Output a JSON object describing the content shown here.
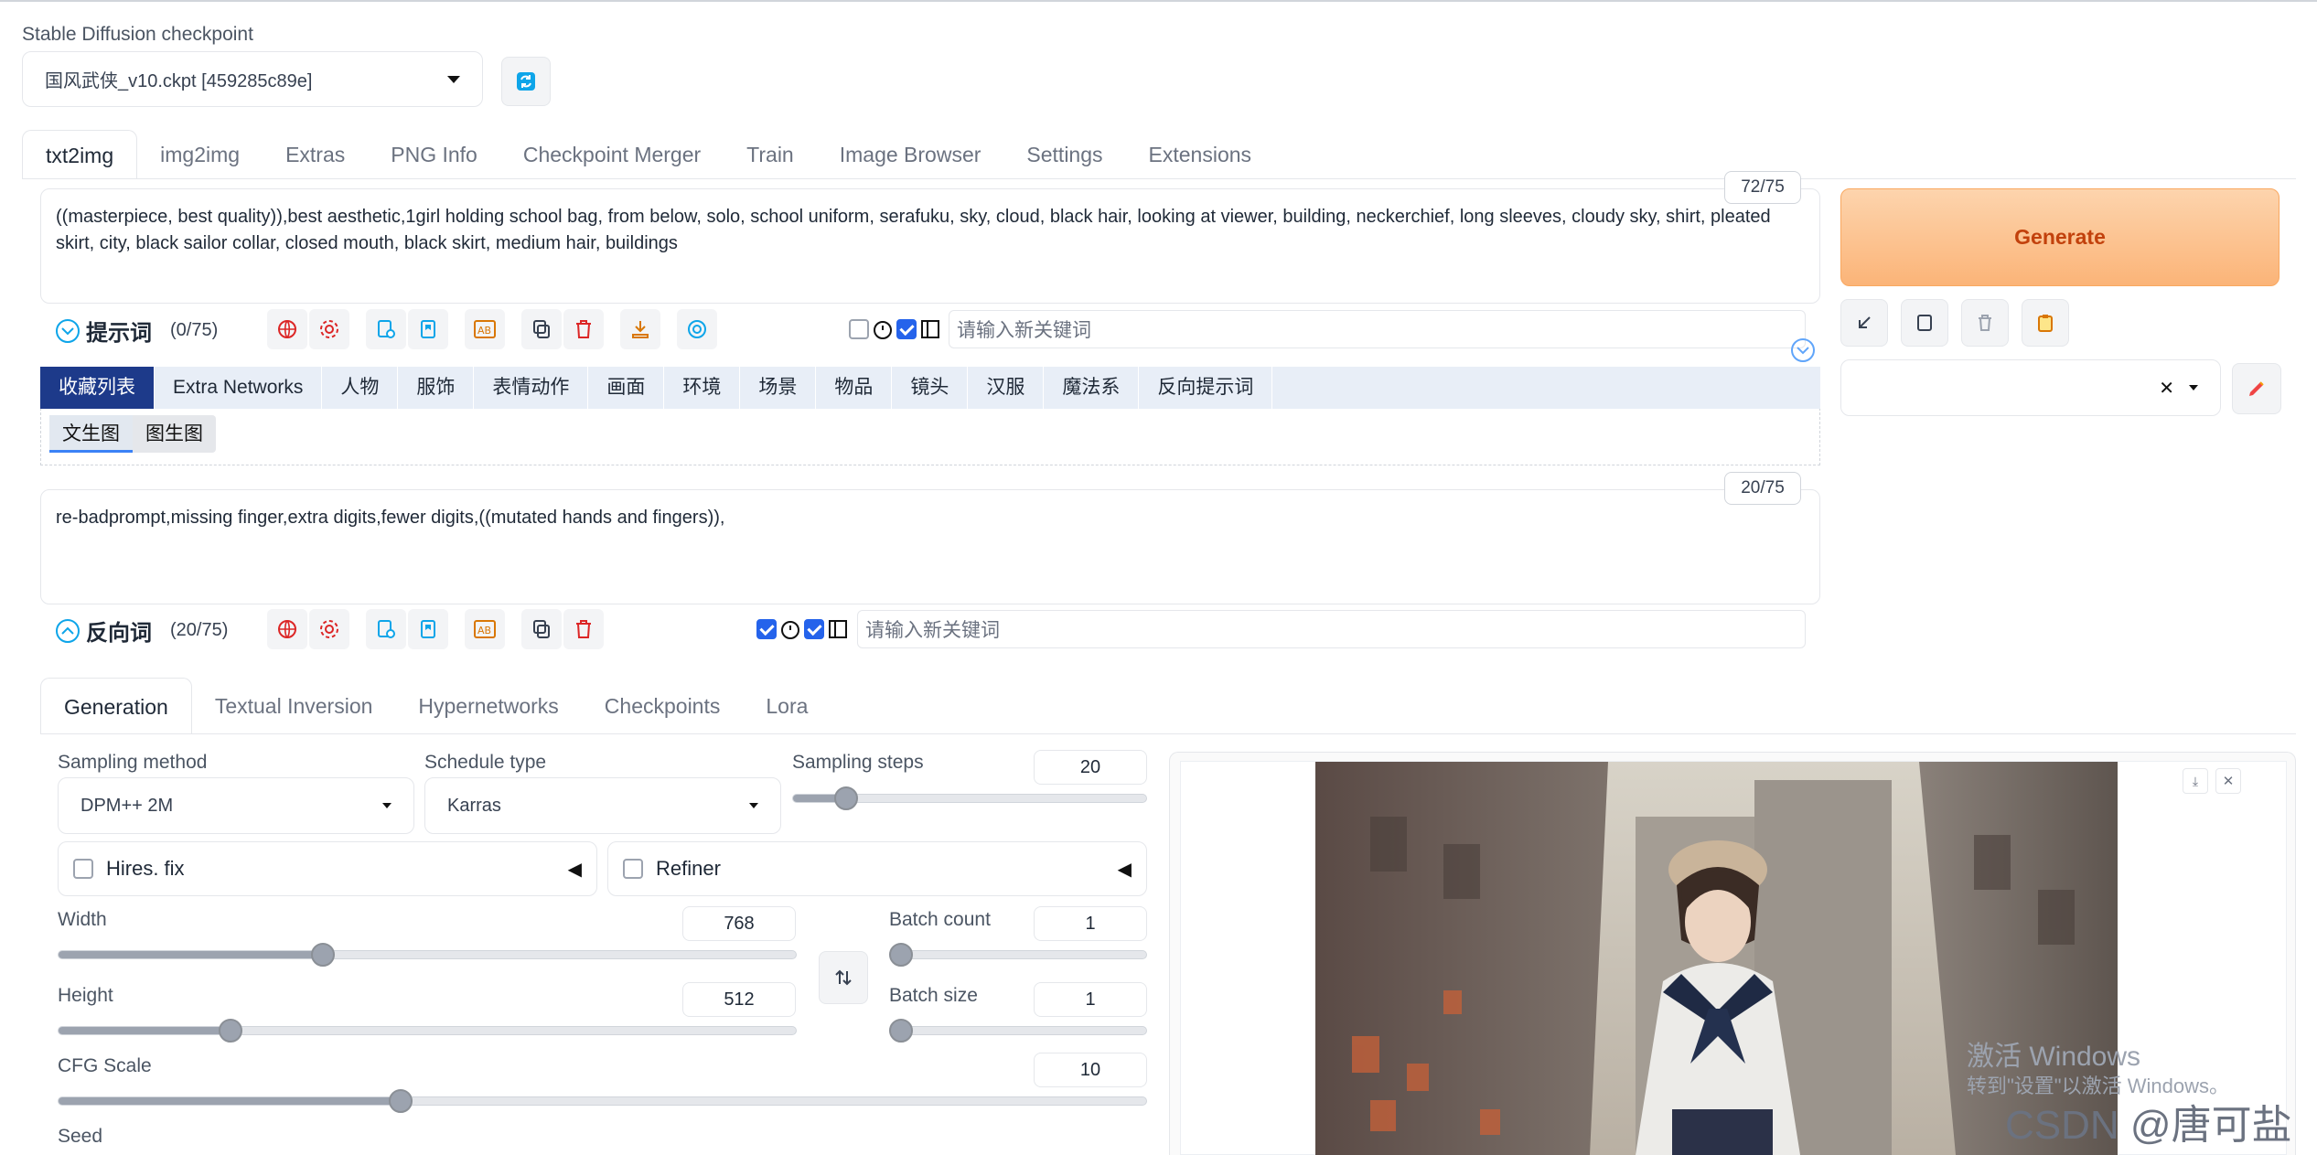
{
  "checkpoint": {
    "label": "Stable Diffusion checkpoint",
    "value": "国风武侠_v10.ckpt [459285c89e]"
  },
  "main_tabs": [
    "txt2img",
    "img2img",
    "Extras",
    "PNG Info",
    "Checkpoint Merger",
    "Train",
    "Image Browser",
    "Settings",
    "Extensions"
  ],
  "prompt": {
    "counter": "72/75",
    "text": "((masterpiece, best quality)),best aesthetic,1girl holding school bag, from below, solo, school uniform, serafuku, sky, cloud, black hair, looking at viewer, building, neckerchief, long sleeves, cloudy sky, shirt, pleated skirt, city, black sailor collar, closed mouth, black skirt, medium hair, buildings",
    "helper_title": "提示词",
    "helper_count": "(0/75)",
    "keyword_placeholder": "请输入新关键词"
  },
  "category_tabs": [
    "收藏列表",
    "Extra Networks",
    "人物",
    "服饰",
    "表情动作",
    "画面",
    "环境",
    "场景",
    "物品",
    "镜头",
    "汉服",
    "魔法系",
    "反向提示词"
  ],
  "sub_tabs": [
    "文生图",
    "图生图"
  ],
  "negative": {
    "counter": "20/75",
    "text": "re-badprompt,missing finger,extra digits,fewer digits,((mutated hands and fingers)),",
    "helper_title": "反向词",
    "helper_count": "(20/75)",
    "keyword_placeholder": "请输入新关键词"
  },
  "generate_label": "Generate",
  "gen_tabs": [
    "Generation",
    "Textual Inversion",
    "Hypernetworks",
    "Checkpoints",
    "Lora"
  ],
  "params": {
    "sampling_method_label": "Sampling method",
    "sampling_method": "DPM++ 2M",
    "schedule_type_label": "Schedule type",
    "schedule_type": "Karras",
    "sampling_steps_label": "Sampling steps",
    "sampling_steps": "20",
    "hires_label": "Hires. fix",
    "refiner_label": "Refiner",
    "width_label": "Width",
    "width": "768",
    "height_label": "Height",
    "height": "512",
    "batch_count_label": "Batch count",
    "batch_count": "1",
    "batch_size_label": "Batch size",
    "batch_size": "1",
    "cfg_label": "CFG Scale",
    "cfg": "10",
    "seed_label": "Seed"
  },
  "watermark": {
    "line1": "激活 Windows",
    "line2": "转到\"设置\"以激活 Windows。",
    "csdn": "CSDN @唐可盐"
  },
  "colors": {
    "generate_bg": "#fbb478",
    "generate_text": "#c2410c",
    "active_category": "#1d3a8a"
  }
}
